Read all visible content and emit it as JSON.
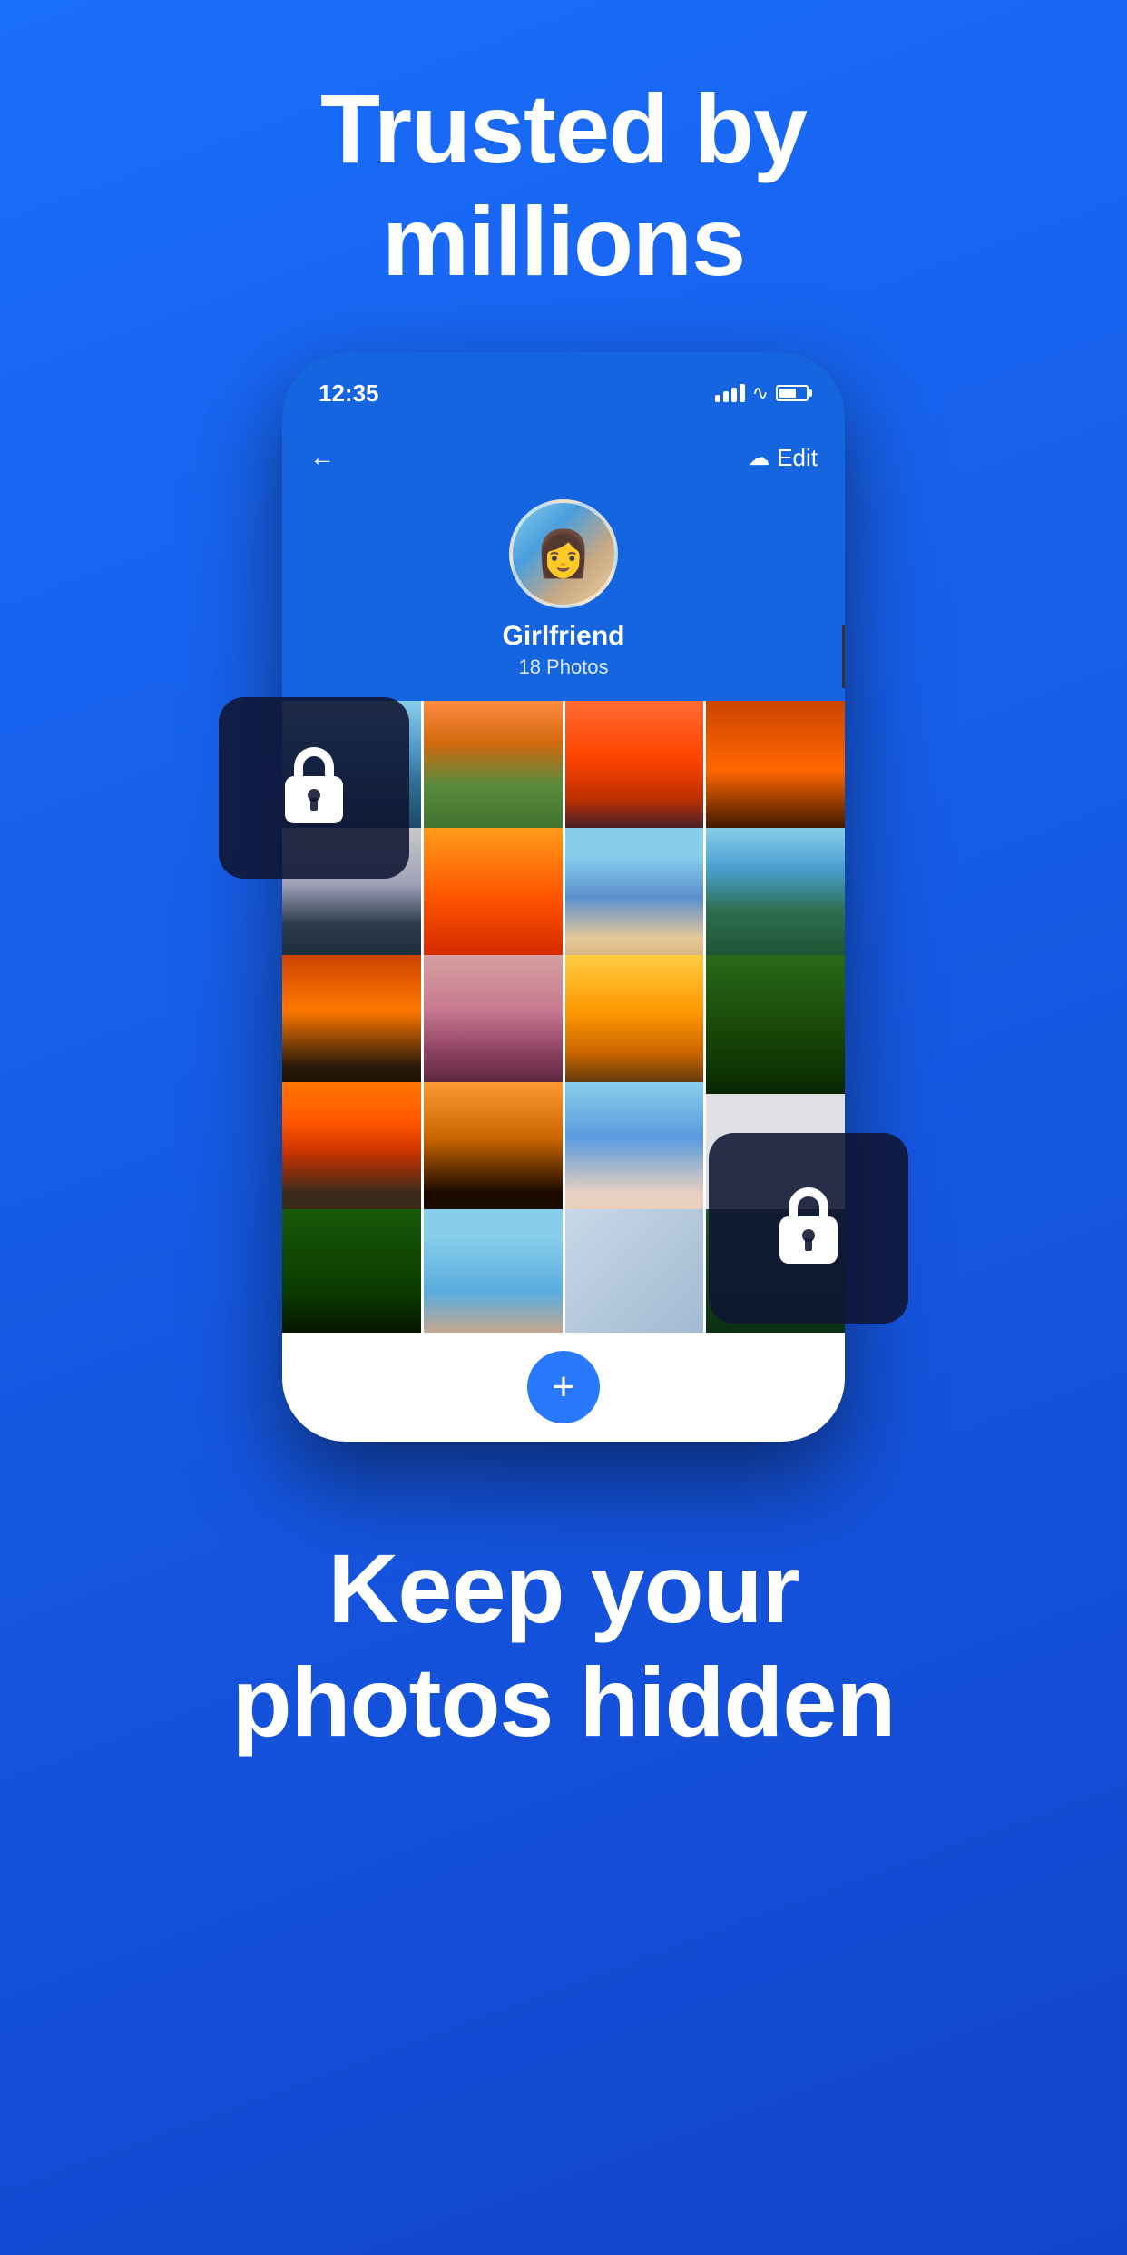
{
  "header": {
    "line1": "Trusted by",
    "line2": "millions"
  },
  "phone": {
    "time": "12:35",
    "edit_label": "Edit",
    "profile_name": "Girlfriend",
    "photo_count": "18 Photos",
    "add_button": "+"
  },
  "footer": {
    "line1": "Keep your",
    "line2": "photos hidden"
  },
  "lock_overlays": {
    "left_aria": "Lock overlay left",
    "right_aria": "Lock overlay right"
  }
}
